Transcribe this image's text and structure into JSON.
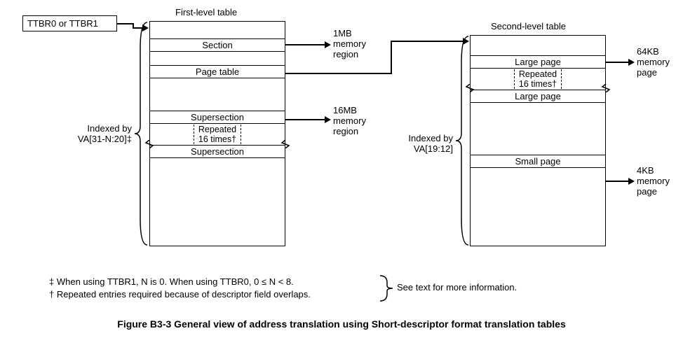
{
  "ttbr_box": "TTBR0 or TTBR1",
  "l1": {
    "title": "First-level table",
    "section": "Section",
    "page_table": "Page table",
    "supersection1": "Supersection",
    "repeated": "Repeated",
    "repeated_suffix": "16 times†",
    "supersection2": "Supersection",
    "index_label_l1": "Indexed by",
    "index_label_l2": "VA[31-N:20]‡",
    "out_section_l1": "1MB",
    "out_section_l2": "memory",
    "out_section_l3": "region",
    "out_super_l1": "16MB",
    "out_super_l2": "memory",
    "out_super_l3": "region"
  },
  "l2": {
    "title": "Second-level table",
    "large_page1": "Large page",
    "repeated": "Repeated",
    "repeated_suffix": "16 times†",
    "large_page2": "Large page",
    "small_page": "Small page",
    "index_label_l1": "Indexed by",
    "index_label_l2": "VA[19:12]",
    "out_large_l1": "64KB",
    "out_large_l2": "memory",
    "out_large_l3": "page",
    "out_small_l1": "4KB",
    "out_small_l2": "memory",
    "out_small_l3": "page"
  },
  "footnotes": {
    "ddagger": "‡ When using TTBR1, N is 0. When using TTBR0, 0 ≤ N < 8.",
    "dagger": "† Repeated entries required because of descriptor field overlaps.",
    "see_text": "See text for more information."
  },
  "caption": "Figure B3-3 General view of address translation using Short-descriptor format translation tables",
  "chart_data": {
    "type": "diagram",
    "title": "General view of address translation using Short-descriptor format translation tables",
    "root_register": "TTBR0 or TTBR1",
    "levels": [
      {
        "name": "First-level table",
        "indexed_by": "VA[31-N:20]",
        "index_note": "When using TTBR1, N is 0. When using TTBR0, 0 ≤ N < 8.",
        "entry_types": [
          {
            "name": "Section",
            "maps": "1MB memory region"
          },
          {
            "name": "Page table",
            "maps": "pointer to Second-level table"
          },
          {
            "name": "Supersection",
            "maps": "16MB memory region",
            "repeated_entries": 16,
            "repeat_reason": "descriptor field overlaps"
          }
        ]
      },
      {
        "name": "Second-level table",
        "indexed_by": "VA[19:12]",
        "entry_types": [
          {
            "name": "Large page",
            "maps": "64KB memory page",
            "repeated_entries": 16,
            "repeat_reason": "descriptor field overlaps"
          },
          {
            "name": "Small page",
            "maps": "4KB memory page"
          }
        ]
      }
    ]
  }
}
